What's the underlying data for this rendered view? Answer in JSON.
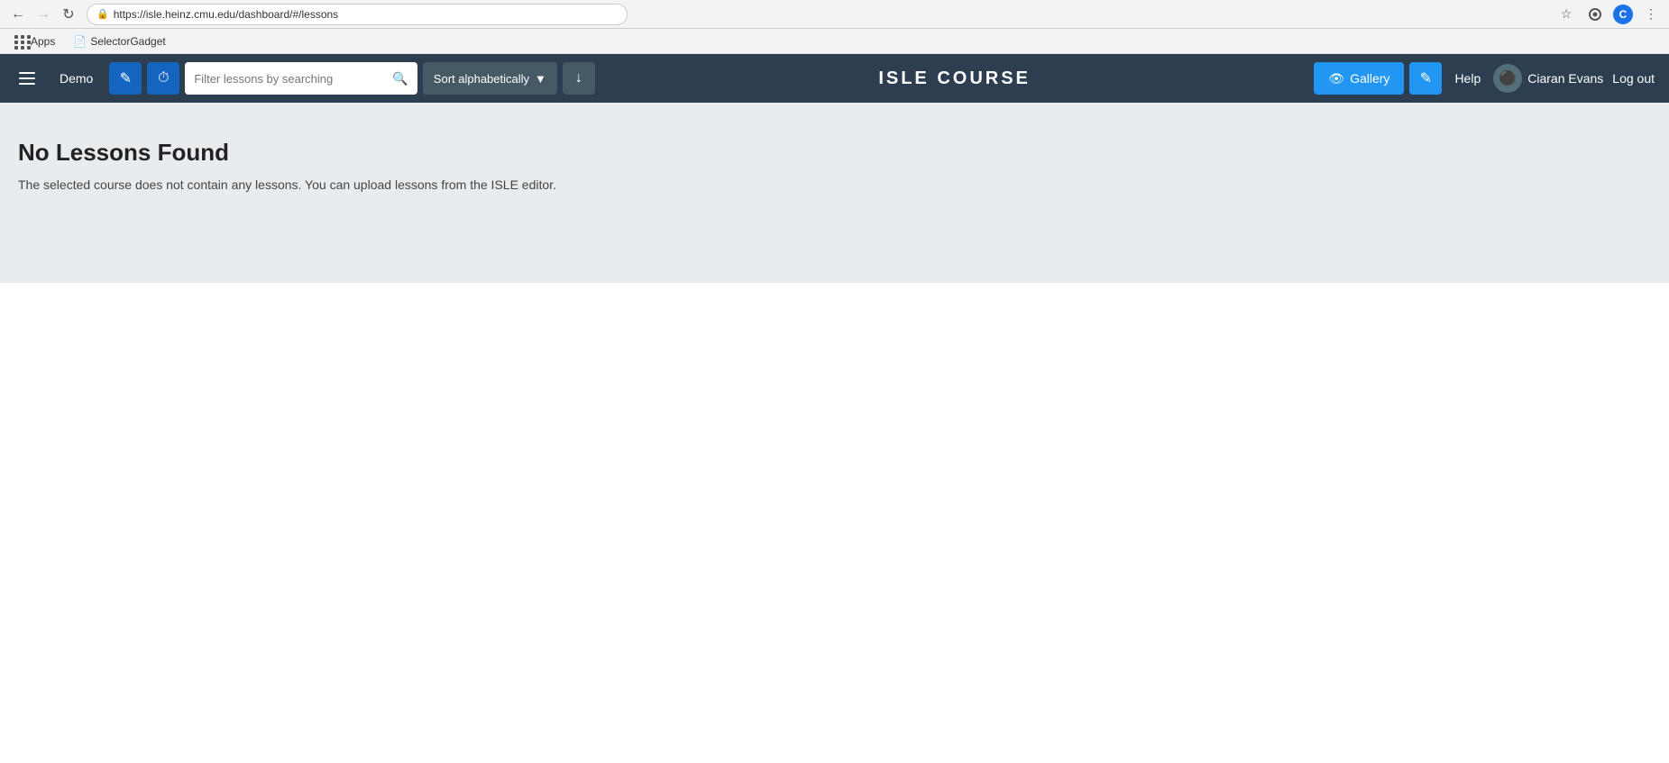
{
  "browser": {
    "url": "https://isle.heinz.cmu.edu/dashboard/#/lessons",
    "back_disabled": false,
    "forward_disabled": true,
    "user_initial": "C"
  },
  "bookmarks": {
    "apps_label": "Apps",
    "selector_gadget_label": "SelectorGadget"
  },
  "navbar": {
    "demo_label": "Demo",
    "search_placeholder": "Filter lessons by searching",
    "sort_label": "Sort alphabetically",
    "title": "ISLE  COURSE",
    "gallery_label": "Gallery",
    "help_label": "Help",
    "username": "Ciaran Evans",
    "logout_label": "Log out"
  },
  "content": {
    "no_lessons_title": "No Lessons Found",
    "no_lessons_desc": "The selected course does not contain any lessons. You can upload lessons from the ISLE editor."
  }
}
